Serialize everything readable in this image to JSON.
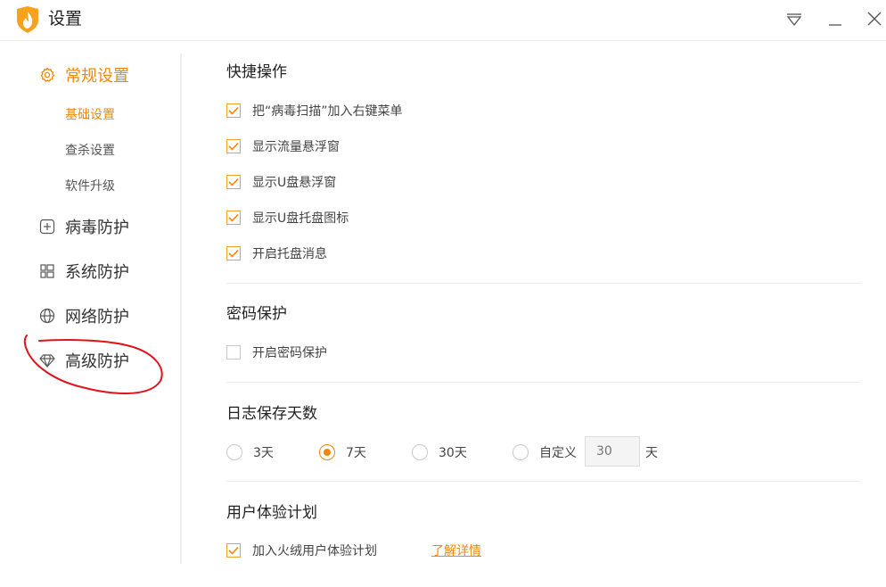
{
  "window": {
    "title": "设置"
  },
  "sidebar": {
    "groups": [
      {
        "label": "常规设置",
        "icon": "gear-icon",
        "active": true,
        "items": [
          {
            "label": "基础设置",
            "active": true
          },
          {
            "label": "查杀设置",
            "active": false
          },
          {
            "label": "软件升级",
            "active": false
          }
        ]
      },
      {
        "label": "病毒防护",
        "icon": "plus-box-icon"
      },
      {
        "label": "系统防护",
        "icon": "windows-icon"
      },
      {
        "label": "网络防护",
        "icon": "globe-icon"
      },
      {
        "label": "高级防护",
        "icon": "diamond-icon"
      }
    ]
  },
  "quick_actions": {
    "title": "快捷操作",
    "options": [
      {
        "label": "把“病毒扫描”加入右键菜单",
        "checked": true
      },
      {
        "label": "显示流量悬浮窗",
        "checked": true
      },
      {
        "label": "显示U盘悬浮窗",
        "checked": true
      },
      {
        "label": "显示U盘托盘图标",
        "checked": true
      },
      {
        "label": "开启托盘消息",
        "checked": true
      }
    ]
  },
  "password": {
    "title": "密码保护",
    "option": {
      "label": "开启密码保护",
      "checked": false
    }
  },
  "log_days": {
    "title": "日志保存天数",
    "options": [
      {
        "label": "3天",
        "selected": false
      },
      {
        "label": "7天",
        "selected": true
      },
      {
        "label": "30天",
        "selected": false
      },
      {
        "label": "自定义",
        "selected": false
      }
    ],
    "custom_placeholder": "30",
    "unit": "天"
  },
  "ux_plan": {
    "title": "用户体验计划",
    "option": {
      "label": "加入火绒用户体验计划",
      "checked": true
    },
    "link": "了解详情"
  },
  "colors": {
    "accent": "#f0870a",
    "annotation": "#e0141a"
  }
}
